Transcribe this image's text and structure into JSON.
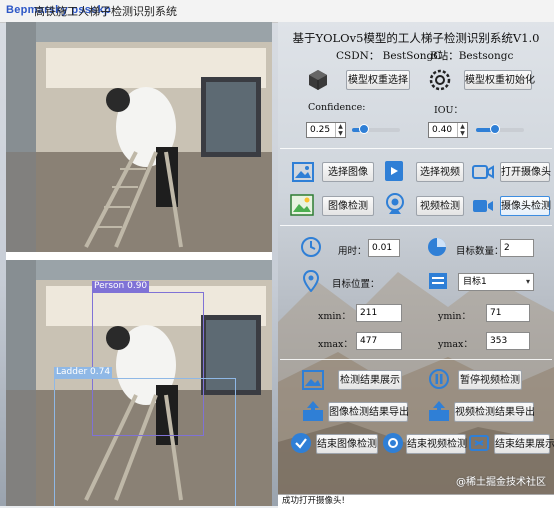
{
  "window": {
    "title": "高铁施工人梯子检测识别系统",
    "watermark_overlay": "Bepmarsky pssskp"
  },
  "detections": [
    {
      "label": "Person  0.90",
      "color": "#7f72d6"
    },
    {
      "label": "Ladder  0.74",
      "color": "#8fb8e6"
    }
  ],
  "header": {
    "title": "基于YOLOv5模型的工人梯子检测识别系统V1.0",
    "csdn": "CSDN： BestSongC",
    "bilibili": "B站：Bestsongc"
  },
  "model": {
    "select_label": "模型权重选择",
    "init_label": "模型权重初始化"
  },
  "params": {
    "confidence_label": "Confidence:",
    "confidence_value": "0.25",
    "confidence_fraction": 0.25,
    "iou_label": "IOU：",
    "iou_value": "0.40",
    "iou_fraction": 0.4
  },
  "actions": {
    "select_image": "选择图像",
    "select_video": "选择视频",
    "open_camera": "打开摄像头",
    "image_detect": "图像检测",
    "video_detect": "视频检测",
    "camera_detect": "摄像头检测"
  },
  "stats": {
    "time_label": "用时：",
    "time_value": "0.01",
    "count_label": "目标数量：",
    "count_value": "2",
    "position_label": "目标位置：",
    "target_select": "目标1",
    "xmin_label": "xmin：",
    "xmin_value": "211",
    "ymin_label": "ymin：",
    "ymin_value": "71",
    "xmax_label": "xmax：",
    "xmax_value": "477",
    "ymax_label": "ymax：",
    "ymax_value": "353"
  },
  "results": {
    "show_results": "检测结果展示",
    "pause_video": "暂停视频检测",
    "export_image": "图像检测结果导出",
    "export_video": "视频检测结果导出",
    "end_image": "结束图像检测",
    "end_video": "结束视频检测",
    "end_results": "结束结果展示"
  },
  "status": {
    "message": "成功打开摄像头!"
  },
  "site_watermark": "@稀土掘金技术社区",
  "colors": {
    "accent": "#2f7fd6",
    "person_box": "#7f72d6",
    "ladder_box": "#8fb8e6"
  }
}
